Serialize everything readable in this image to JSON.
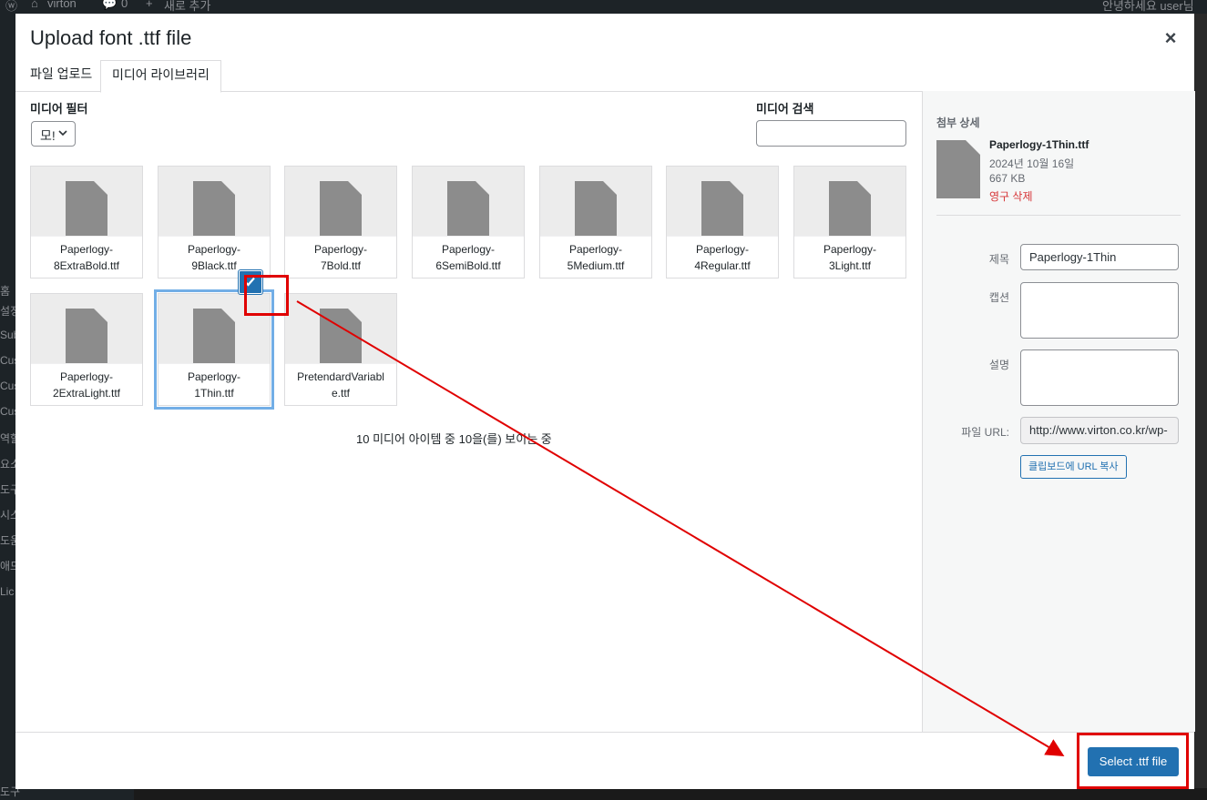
{
  "backdrop": {
    "site_name": "virton",
    "comments_count": "0",
    "new_item": "새로 추가",
    "greeting": "안녕하세요 user님",
    "menu_fragments": [
      "홈",
      "설정",
      "Sub",
      "Cus",
      "Cus",
      "Cus",
      "역할",
      "요소",
      "도구",
      "시스",
      "도움",
      "애드",
      "Lic",
      "도구"
    ]
  },
  "modal": {
    "title": "Upload font .ttf file",
    "close_label": "×",
    "tabs": [
      {
        "label": "파일 업로드"
      },
      {
        "label": "미디어 라이브러리"
      }
    ]
  },
  "toolbar": {
    "filter_label": "미디어 필터",
    "filter_value": "모!",
    "search_label": "미디어 검색",
    "search_value": ""
  },
  "media_items": [
    {
      "name": "Paperlogy-8ExtraBold.ttf",
      "line1": "Paperlogy-",
      "line2": "8ExtraBold.ttf"
    },
    {
      "name": "Paperlogy-9Black.ttf",
      "line1": "Paperlogy-",
      "line2": "9Black.ttf"
    },
    {
      "name": "Paperlogy-7Bold.ttf",
      "line1": "Paperlogy-",
      "line2": "7Bold.ttf"
    },
    {
      "name": "Paperlogy-6SemiBold.ttf",
      "line1": "Paperlogy-",
      "line2": "6SemiBold.ttf"
    },
    {
      "name": "Paperlogy-5Medium.ttf",
      "line1": "Paperlogy-",
      "line2": "5Medium.ttf"
    },
    {
      "name": "Paperlogy-4Regular.ttf",
      "line1": "Paperlogy-",
      "line2": "4Regular.ttf"
    },
    {
      "name": "Paperlogy-3Light.ttf",
      "line1": "Paperlogy-",
      "line2": "3Light.ttf"
    },
    {
      "name": "Paperlogy-2ExtraLight.ttf",
      "line1": "Paperlogy-",
      "line2": "2ExtraLight.ttf"
    },
    {
      "name": "Paperlogy-1Thin.ttf",
      "line1": "Paperlogy-",
      "line2": "1Thin.ttf",
      "selected": true
    },
    {
      "name": "PretendardVariable.ttf",
      "line1": "PretendardVariabl",
      "line2": "e.ttf"
    }
  ],
  "count_text": "10 미디어 아이템 중 10을(를) 보이는 중",
  "details": {
    "heading": "첨부 상세",
    "filename": "Paperlogy-1Thin.ttf",
    "date": "2024년 10월 16일",
    "size": "667 KB",
    "delete_label": "영구 삭제",
    "title_label": "제목",
    "title_value": "Paperlogy-1Thin",
    "caption_label": "캡션",
    "caption_value": "",
    "description_label": "설명",
    "description_value": "",
    "url_label": "파일 URL:",
    "url_value": "http://www.virton.co.kr/wp-",
    "copy_label": "클립보드에 URL 복사"
  },
  "footer": {
    "select_label": "Select .ttf file"
  },
  "colors": {
    "primary": "#2271b1",
    "selection_outline": "#72aee6",
    "danger": "#d63638",
    "annotation": "#e00000"
  }
}
